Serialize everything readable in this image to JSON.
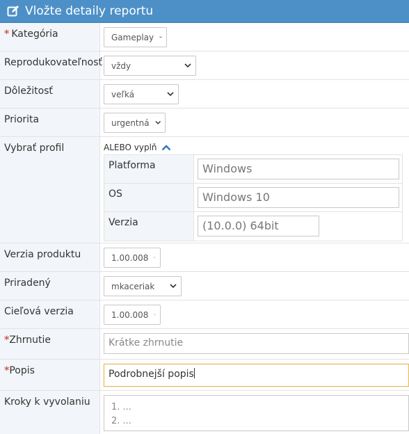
{
  "header": {
    "title": "Vložte detaily reportu",
    "icon": "edit-icon"
  },
  "form": {
    "category": {
      "label": "Kategória",
      "required": "*",
      "value": "Gameplay"
    },
    "reproducibility": {
      "label": "Reprodukovateľnosť",
      "value": "vždy"
    },
    "severity": {
      "label": "Dôležitosť",
      "value": "veľká"
    },
    "priority": {
      "label": "Priorita",
      "value": "urgentná"
    },
    "profile": {
      "label": "Vybrať profil",
      "toggle_label": "ALEBO vyplň",
      "platform": {
        "label": "Platforma",
        "value": "Windows"
      },
      "os": {
        "label": "OS",
        "value": "Windows 10"
      },
      "version": {
        "label": "Verzia",
        "value": "(10.0.0) 64bit"
      }
    },
    "product_version": {
      "label": "Verzia produktu",
      "value": "1.00.008"
    },
    "assigned": {
      "label": "Priradený",
      "value": "mkaceriak"
    },
    "target_version": {
      "label": "Cieľová verzia",
      "value": "1.00.008"
    },
    "summary": {
      "label": "Zhrnutie",
      "required": "*",
      "placeholder": "Krátke zhrnutie"
    },
    "description": {
      "label": "Popis",
      "required": "*",
      "value": "Podrobnejší popis"
    },
    "steps": {
      "label": "Kroky k vyvolaniu",
      "line1": "1. ...",
      "line2": "2. ..."
    }
  },
  "colors": {
    "header": "#4d90c8",
    "label_bg": "#f2f6fa",
    "required": "#d15b47",
    "focus_border": "#e7b552"
  }
}
